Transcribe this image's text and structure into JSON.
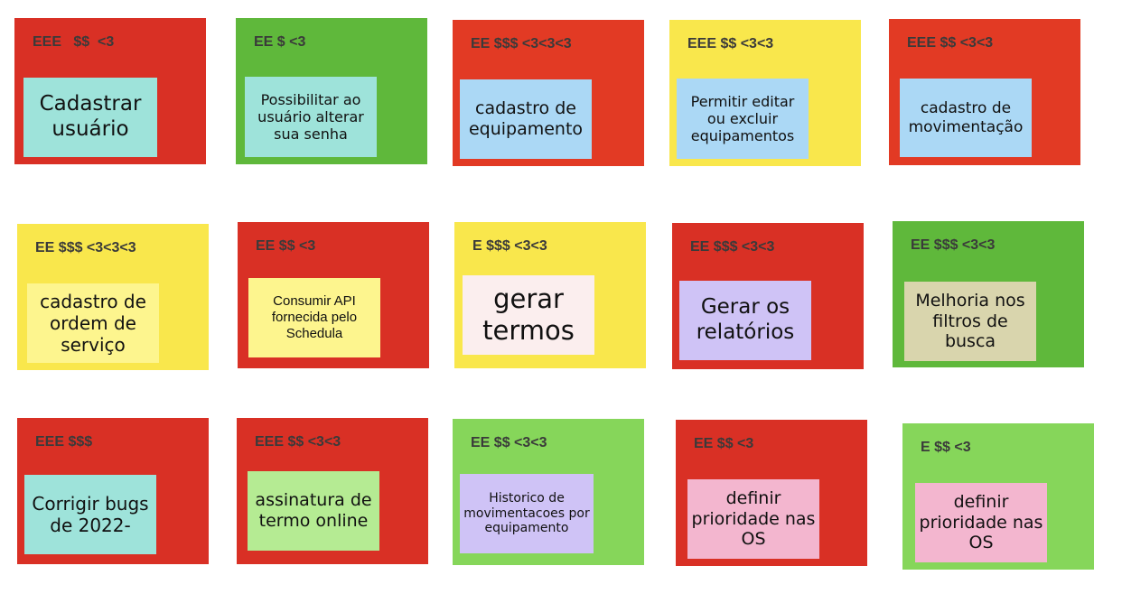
{
  "cards": [
    {
      "label": "EEE   $$  <3",
      "note": "Cadastrar usuário"
    },
    {
      "label": "EE $ <3",
      "note": "Possibilitar ao usuário alterar sua senha"
    },
    {
      "label": "EE $$$ <3<3<3",
      "note": "cadastro de equipamento"
    },
    {
      "label": "EEE $$ <3<3",
      "note": "Permitir editar ou excluir equipamentos"
    },
    {
      "label": "EEE $$ <3<3",
      "note": "cadastro de movimentação"
    },
    {
      "label": "EE $$$ <3<3<3",
      "note": "cadastro de ordem de serviço"
    },
    {
      "label": "EE $$ <3",
      "note": "Consumir API fornecida pelo Schedula"
    },
    {
      "label": "E $$$ <3<3",
      "note": "gerar termos"
    },
    {
      "label": "EE $$$ <3<3",
      "note": "Gerar os relatórios"
    },
    {
      "label": "EE $$$ <3<3",
      "note": "Melhoria nos filtros de busca"
    },
    {
      "label": "EEE $$$",
      "note": "Corrigir bugs de 2022-"
    },
    {
      "label": "EEE $$ <3<3",
      "note": "assinatura de termo online"
    },
    {
      "label": "EE $$ <3<3",
      "note": "Historico de movimentacoes por equipamento"
    },
    {
      "label": "EE $$ <3",
      "note": "definir prioridade nas OS"
    },
    {
      "label": "E $$ <3",
      "note": "definir prioridade nas OS"
    }
  ]
}
